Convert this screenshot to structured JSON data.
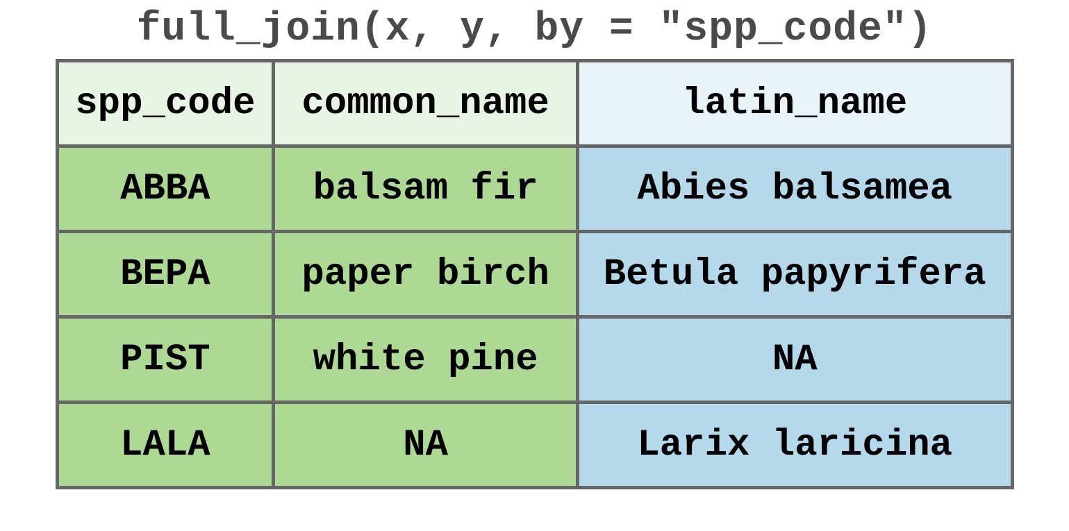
{
  "title": "full_join(x, y, by = \"spp_code\")",
  "headers": {
    "spp_code": "spp_code",
    "common_name": "common_name",
    "latin_name": "latin_name"
  },
  "rows": [
    {
      "spp_code": "ABBA",
      "common_name": "balsam fir",
      "common_na": false,
      "latin_name": "Abies balsamea",
      "latin_na": false
    },
    {
      "spp_code": "BEPA",
      "common_name": "paper birch",
      "common_na": false,
      "latin_name": "Betula papyrifera",
      "latin_na": false
    },
    {
      "spp_code": "PIST",
      "common_name": "white pine",
      "common_na": false,
      "latin_name": "NA",
      "latin_na": true
    },
    {
      "spp_code": "LALA",
      "common_name": "NA",
      "common_na": true,
      "latin_name": "Larix laricina",
      "latin_na": false
    }
  ],
  "colors": {
    "header_green": "#e9f5e4",
    "header_blue": "#e9f3fa",
    "cell_green": "#aed994",
    "cell_blue": "#b5d8eb",
    "border": "#666666",
    "na": "#c62828"
  },
  "chart_data": {
    "type": "table",
    "title": "full_join(x, y, by = \"spp_code\")",
    "columns": [
      "spp_code",
      "common_name",
      "latin_name"
    ],
    "column_sources": {
      "spp_code": "x",
      "common_name": "x",
      "latin_name": "y"
    },
    "data": [
      {
        "spp_code": "ABBA",
        "common_name": "balsam fir",
        "latin_name": "Abies balsamea"
      },
      {
        "spp_code": "BEPA",
        "common_name": "paper birch",
        "latin_name": "Betula papyrifera"
      },
      {
        "spp_code": "PIST",
        "common_name": "white pine",
        "latin_name": null
      },
      {
        "spp_code": "LALA",
        "common_name": null,
        "latin_name": "Larix laricina"
      }
    ]
  }
}
